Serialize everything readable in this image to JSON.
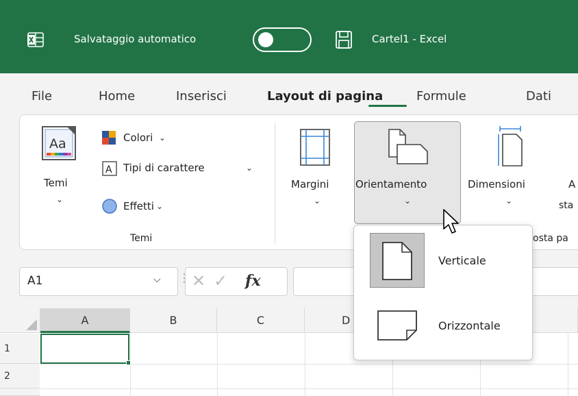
{
  "titlebar": {
    "autosave_label": "Salvataggio automatico",
    "doc_title": "Cartel1  -  Excel"
  },
  "tabs": [
    {
      "label": "File"
    },
    {
      "label": "Home"
    },
    {
      "label": "Inserisci"
    },
    {
      "label": "Layout di pagina",
      "active": true
    },
    {
      "label": "Formule"
    },
    {
      "label": "Dati"
    }
  ],
  "ribbon": {
    "temi_button": "Temi",
    "colori": "Colori",
    "tipi_carattere": "Tipi di carattere",
    "effetti": "Effetti",
    "temi_group": "Temi",
    "margini": "Margini",
    "orientamento": "Orientamento",
    "dimensioni": "Dimensioni",
    "partial_next_top": "A",
    "partial_next_bottom": "sta",
    "partial_group": "osta pa"
  },
  "formula_bar": {
    "namebox_value": "A1",
    "fx_label": "fx"
  },
  "grid": {
    "columns": [
      "A",
      "B",
      "C",
      "D"
    ],
    "rows": [
      "1",
      "2"
    ]
  },
  "dropdown": {
    "items": [
      {
        "label": "Verticale",
        "icon": "portrait-page-icon"
      },
      {
        "label": "Orizzontale",
        "icon": "landscape-page-icon"
      }
    ]
  },
  "colors": {
    "brand": "#217346",
    "accent_underline": "#217346",
    "selected_item": "#c6c6c6"
  }
}
